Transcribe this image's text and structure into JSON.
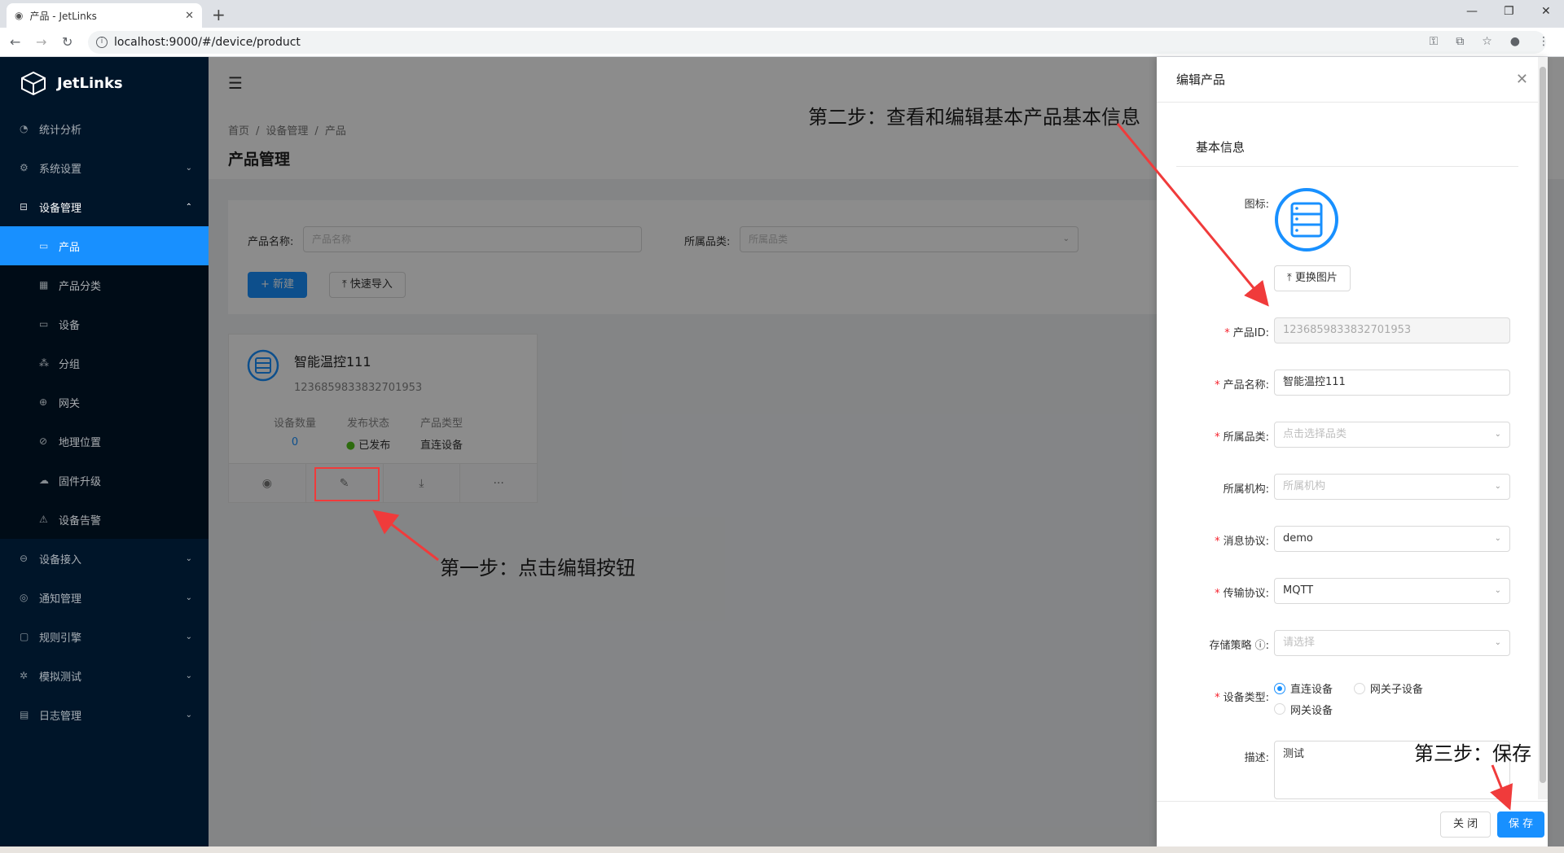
{
  "browser": {
    "tab_title": "产品 - JetLinks",
    "url": "localhost:9000/#/device/product"
  },
  "sidebar": {
    "brand": "JetLinks",
    "items": [
      {
        "label": "统计分析",
        "icon": "dashboard-icon"
      },
      {
        "label": "系统设置",
        "icon": "setting-icon"
      },
      {
        "label": "设备管理",
        "icon": "device-icon"
      },
      {
        "label": "产品",
        "icon": "laptop-icon"
      },
      {
        "label": "产品分类",
        "icon": "category-icon"
      },
      {
        "label": "设备",
        "icon": "desktop-icon"
      },
      {
        "label": "分组",
        "icon": "cluster-icon"
      },
      {
        "label": "网关",
        "icon": "global-icon"
      },
      {
        "label": "地理位置",
        "icon": "compass-icon"
      },
      {
        "label": "固件升级",
        "icon": "cloud-icon"
      },
      {
        "label": "设备告警",
        "icon": "alert-icon"
      },
      {
        "label": "设备接入",
        "icon": "link-icon"
      },
      {
        "label": "通知管理",
        "icon": "notification-icon"
      },
      {
        "label": "规则引擎",
        "icon": "rule-icon"
      },
      {
        "label": "模拟测试",
        "icon": "bug-icon"
      },
      {
        "label": "日志管理",
        "icon": "calendar-icon"
      }
    ]
  },
  "breadcrumb": [
    "首页",
    "设备管理",
    "产品"
  ],
  "page_title": "产品管理",
  "filter": {
    "name_label": "产品名称:",
    "name_placeholder": "产品名称",
    "category_label": "所属品类:",
    "category_placeholder": "所属品类",
    "new_button": "+ 新建",
    "import_button": "快速导入"
  },
  "product_card": {
    "name": "智能温控111",
    "id": "1236859833832701953",
    "stats": [
      {
        "label": "设备数量",
        "value": "0"
      },
      {
        "label": "发布状态",
        "value": "已发布"
      },
      {
        "label": "产品类型",
        "value": "直连设备"
      }
    ],
    "more": "···"
  },
  "drawer": {
    "title": "编辑产品",
    "section": "基本信息",
    "icon_label": "图标:",
    "change_image": "更换图片",
    "fields": {
      "product_id": {
        "label": "产品ID:",
        "value": "1236859833832701953"
      },
      "product_name": {
        "label": "产品名称:",
        "value": "智能温控111"
      },
      "category": {
        "label": "所属品类:",
        "placeholder": "点击选择品类"
      },
      "org": {
        "label": "所属机构:",
        "placeholder": "所属机构"
      },
      "message_protocol": {
        "label": "消息协议:",
        "value": "demo"
      },
      "transport_protocol": {
        "label": "传输协议:",
        "value": "MQTT"
      },
      "storage_policy": {
        "label": "存储策略",
        "placeholder": "请选择"
      },
      "device_type": {
        "label": "设备类型:",
        "options": [
          "直连设备",
          "网关子设备",
          "网关设备"
        ],
        "selected": "直连设备"
      },
      "description": {
        "label": "描述:",
        "value": "测试"
      }
    },
    "close_button": "关 闭",
    "save_button": "保 存"
  },
  "annotations": {
    "step1": "第一步：点击编辑按钮",
    "step2": "第二步：查看和编辑基本产品基本信息",
    "step3": "第三步：保存"
  },
  "colors": {
    "primary": "#1890ff",
    "sidebar": "#001529",
    "annotation_red": "#f03b3b",
    "status_green": "#52c41a"
  }
}
